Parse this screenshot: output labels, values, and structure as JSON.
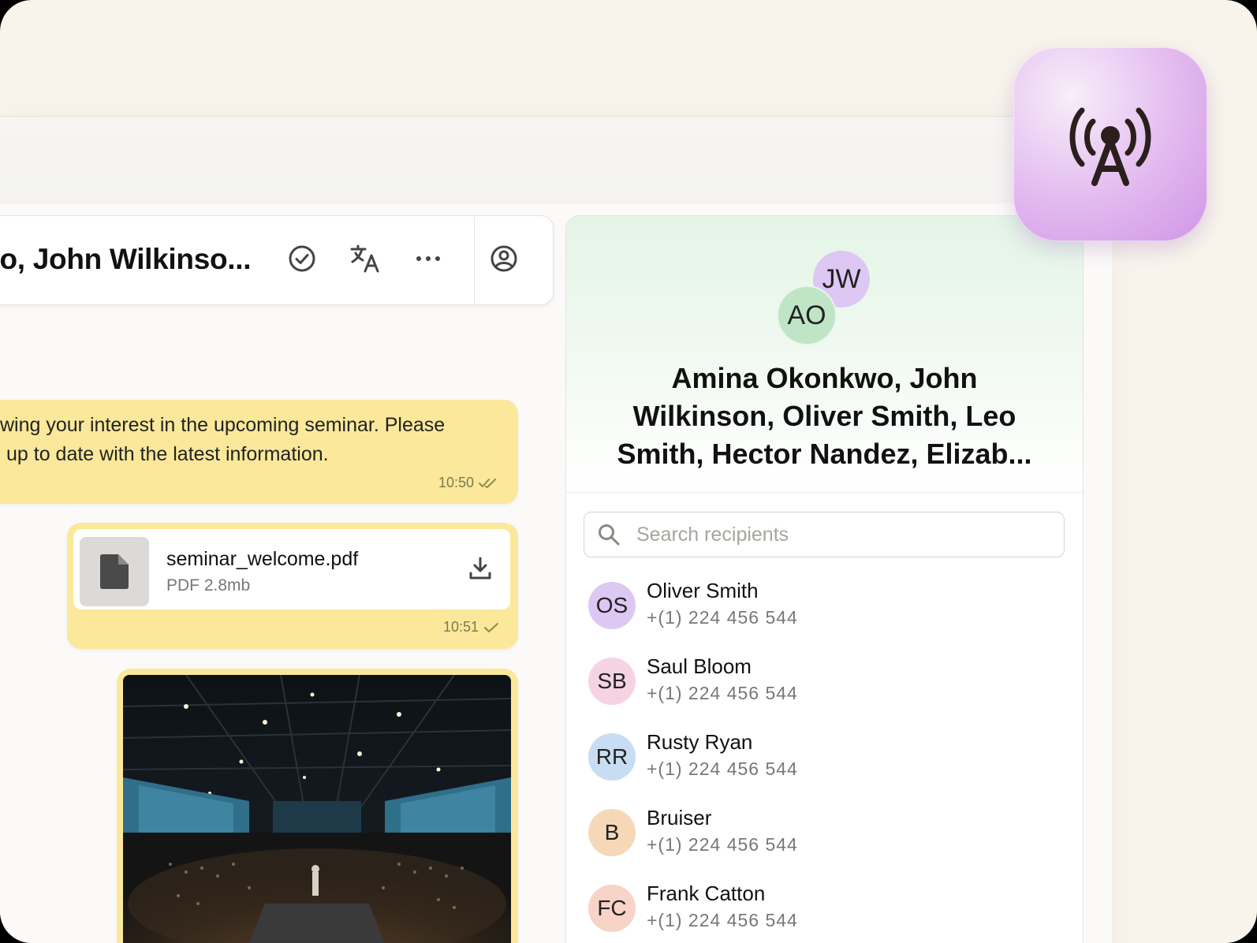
{
  "chat": {
    "title": "wo, John Wilkinso..."
  },
  "messages": [
    {
      "line1": "wing your interest in the upcoming seminar. Please",
      "line2": "up to date with the latest information.",
      "time": "10:50"
    },
    {
      "file_name": "seminar_welcome.pdf",
      "file_meta": "PDF 2.8mb",
      "time": "10:51"
    }
  ],
  "panel": {
    "avatar_back": "JW",
    "avatar_front": "AO",
    "group_name": "Amina Okonkwo, John Wilkinson, Oliver Smith, Leo Smith, Hector Nandez, Elizab...",
    "search_placeholder": "Search recipients",
    "recipients": [
      {
        "initials": "OS",
        "name": "Oliver Smith",
        "phone": "+(1) 224 456 544",
        "color": "#dcc8f2"
      },
      {
        "initials": "SB",
        "name": "Saul Bloom",
        "phone": "+(1) 224 456 544",
        "color": "#f6d3e3"
      },
      {
        "initials": "RR",
        "name": "Rusty Ryan",
        "phone": "+(1) 224 456 544",
        "color": "#c7ddf3"
      },
      {
        "initials": "B",
        "name": "Bruiser",
        "phone": "+(1) 224 456 544",
        "color": "#f6d8b8"
      },
      {
        "initials": "FC",
        "name": "Frank Catton",
        "phone": "+(1) 224 456 544",
        "color": "#f7d3c8"
      }
    ]
  },
  "colors": {
    "bubble": "#fbe89a",
    "avatar_jw": "#dcc8f2",
    "avatar_ao": "#bfe5c6",
    "app_icon": "#e2b9ef"
  }
}
